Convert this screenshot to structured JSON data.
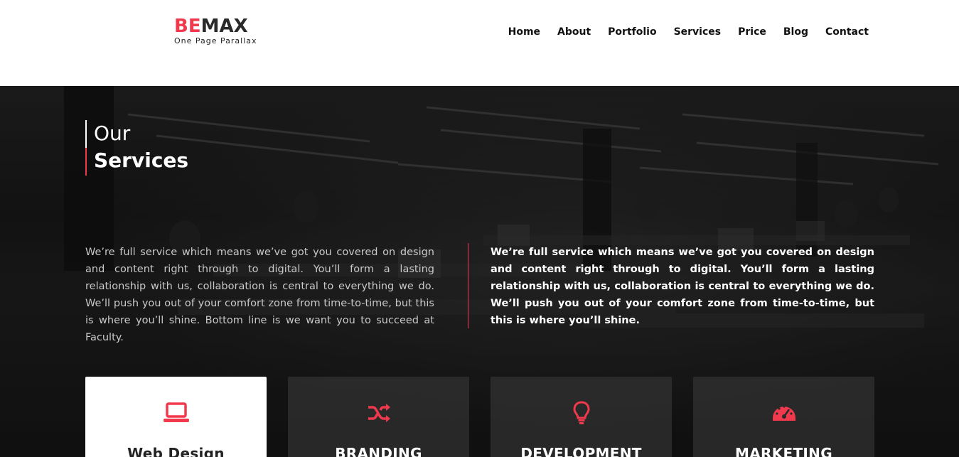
{
  "brand": {
    "logo_part1": "BE",
    "logo_part2": "MAX",
    "tagline": "One Page Parallax",
    "accent_color": "#f0394d"
  },
  "nav": {
    "items": [
      {
        "label": "Home"
      },
      {
        "label": "About"
      },
      {
        "label": "Portfolio"
      },
      {
        "label": "Services"
      },
      {
        "label": "Price"
      },
      {
        "label": "Blog"
      },
      {
        "label": "Contact"
      }
    ]
  },
  "services": {
    "title_light": "Our",
    "title_bold": "Services",
    "para_left": "We’re full service which means we’ve got you covered on design and content right through to digital. You’ll form a lasting relationship with us, collaboration is central to everything we do. We’ll push you out of your comfort zone from time-to-time, but this is where you’ll shine. Bottom line is we want you to succeed at Faculty.",
    "para_right": "We’re full service which means we’ve got you covered on design and content right through to digital. You’ll form a lasting relationship with us, collaboration is central to everything we do. We’ll push you out of your comfort zone from time-to-time, but this is where you’ll shine.",
    "cards": [
      {
        "title": "Web Design",
        "icon": "laptop-icon",
        "active": true
      },
      {
        "title": "BRANDING",
        "icon": "shuffle-icon",
        "active": false
      },
      {
        "title": "DEVELOPMENT",
        "icon": "lightbulb-icon",
        "active": false
      },
      {
        "title": "MARKETING",
        "icon": "speedometer-icon",
        "active": false
      }
    ]
  }
}
